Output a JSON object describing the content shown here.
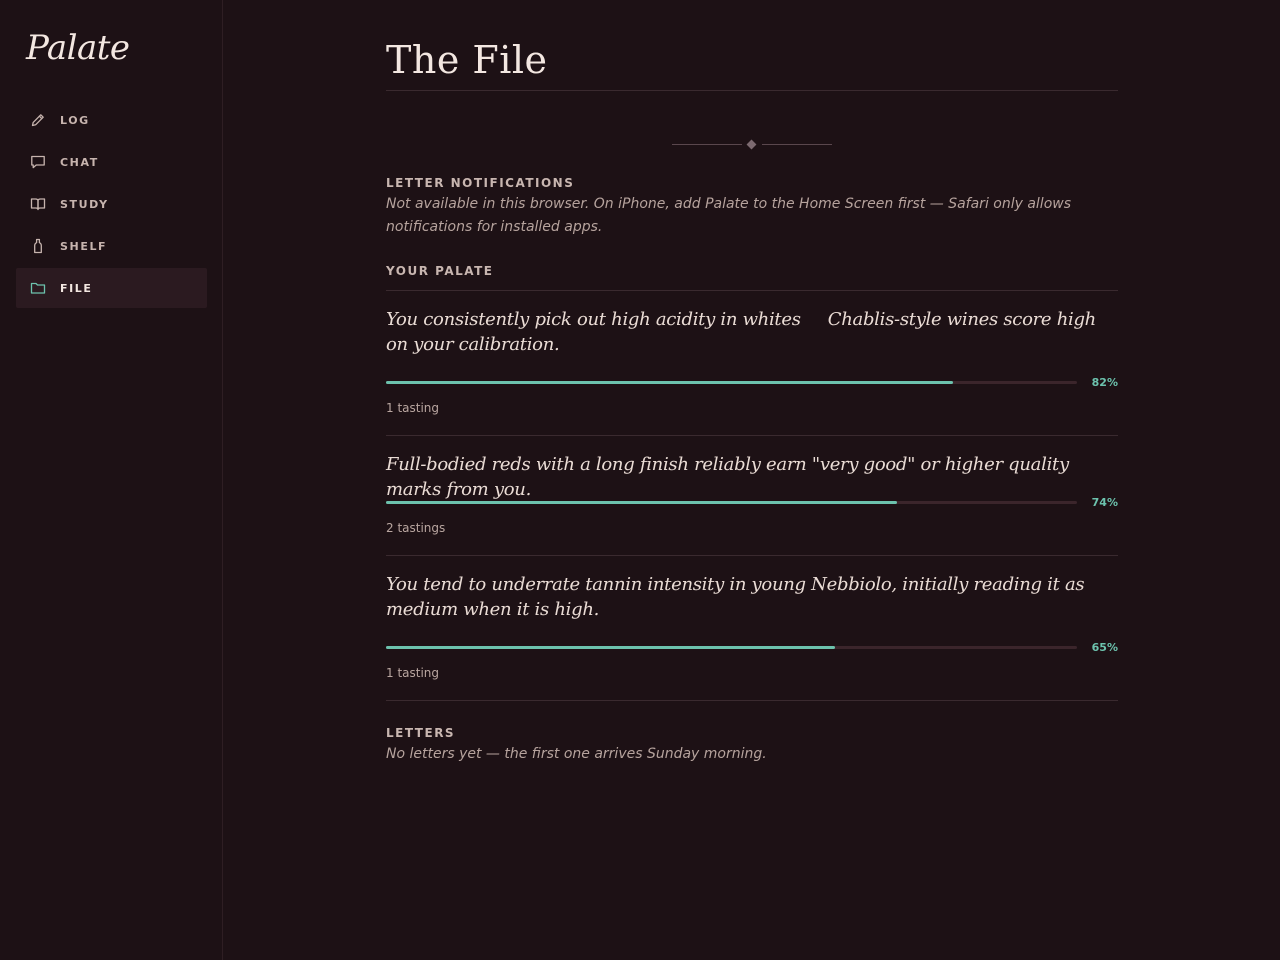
{
  "app": {
    "brand": "Palate"
  },
  "sidebar": {
    "items": [
      {
        "label": "LOG",
        "icon": "pencil-icon",
        "active": false
      },
      {
        "label": "CHAT",
        "icon": "speech-bubble-icon",
        "active": false
      },
      {
        "label": "STUDY",
        "icon": "open-book-icon",
        "active": false
      },
      {
        "label": "SHELF",
        "icon": "bottle-icon",
        "active": false
      },
      {
        "label": "FILE",
        "icon": "folder-icon",
        "active": true
      }
    ]
  },
  "colors": {
    "background": "#1d1115",
    "accent": "#6cc2ad",
    "active_nav_bg": "#2b1a20",
    "track": "#3b252b"
  },
  "main": {
    "title": "The File",
    "notifications": {
      "label": "LETTER NOTIFICATIONS",
      "text": "Not available in this browser. On iPhone, add Palate to the Home Screen first — Safari only allows notifications for installed apps."
    },
    "palate": {
      "label": "YOUR PALATE",
      "traits": [
        {
          "text": "You consistently pick out high acidity in whites     Chablis-style wines score high on your calibration.",
          "percent": 82,
          "percent_label": "82%",
          "count": "1 tasting"
        },
        {
          "text": "Full-bodied reds with a long finish reliably earn \"very good\" or higher quality marks from you.",
          "percent": 74,
          "percent_label": "74%",
          "count": "2 tastings"
        },
        {
          "text": "You tend to underrate tannin intensity in young Nebbiolo, initially reading it as medium when it is high.",
          "percent": 65,
          "percent_label": "65%",
          "count": "1 tasting"
        }
      ]
    },
    "letters": {
      "label": "LETTERS",
      "text": "No letters yet — the first one arrives Sunday morning."
    }
  }
}
